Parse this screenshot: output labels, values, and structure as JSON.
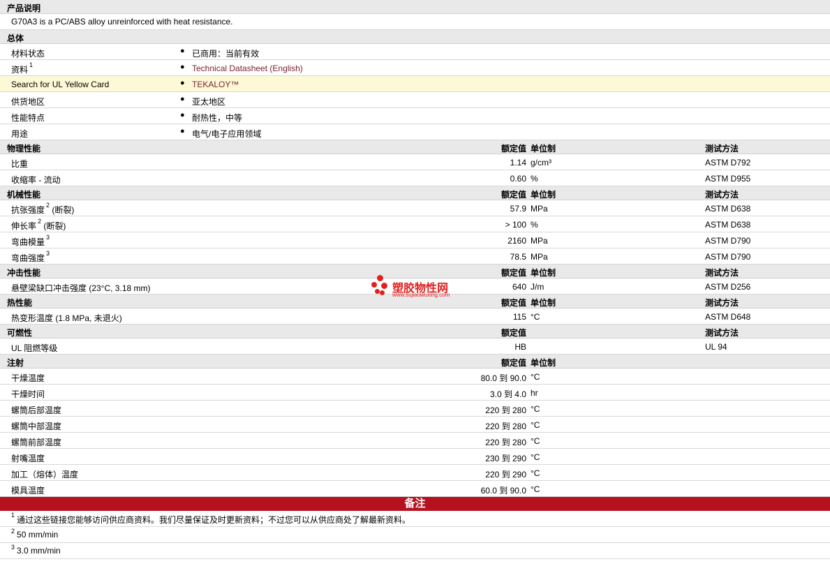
{
  "product": {
    "section": "产品说明",
    "description": "G70A3 is a PC/ABS alloy unreinforced with heat resistance."
  },
  "general": {
    "section": "总体",
    "rows": [
      {
        "label": "材料状态",
        "sup": "",
        "value": "已商用：当前有效",
        "link": false
      },
      {
        "label": "资料",
        "sup": "1",
        "value": "Technical Datasheet (English)",
        "link": true
      },
      {
        "label": "Search for UL Yellow Card",
        "sup": "",
        "value": "TEKALOY™",
        "link": true
      },
      {
        "label": "供货地区",
        "sup": "",
        "value": "亚太地区",
        "link": false
      },
      {
        "label": "性能特点",
        "sup": "",
        "value": "耐热性，中等",
        "link": false
      },
      {
        "label": "用途",
        "sup": "",
        "value": "电气/电子应用领域",
        "link": false
      }
    ]
  },
  "headers": {
    "nominal": "额定值",
    "unit": "单位制",
    "method": "测试方法"
  },
  "physical": {
    "section": "物理性能",
    "rows": [
      {
        "label": "比重",
        "sup": "",
        "value": "1.14",
        "unit": "g/cm³",
        "method": "ASTM D792"
      },
      {
        "label": "收缩率  - 流动",
        "sup": "",
        "value": "0.60",
        "unit": "%",
        "method": "ASTM D955"
      }
    ]
  },
  "mechanical": {
    "section": "机械性能",
    "rows": [
      {
        "label": "抗张强度",
        "sup": "2",
        "suffix": " (断裂)",
        "value": "57.9",
        "unit": "MPa",
        "method": "ASTM D638"
      },
      {
        "label": "伸长率",
        "sup": "2",
        "suffix": " (断裂)",
        "value": "> 100",
        "unit": "%",
        "method": "ASTM D638"
      },
      {
        "label": "弯曲模量",
        "sup": "3",
        "suffix": "",
        "value": "2160",
        "unit": "MPa",
        "method": "ASTM D790"
      },
      {
        "label": "弯曲强度",
        "sup": "3",
        "suffix": "",
        "value": "78.5",
        "unit": "MPa",
        "method": "ASTM D790"
      }
    ]
  },
  "impact": {
    "section": "冲击性能",
    "rows": [
      {
        "label": "悬壁梁缺口冲击强度 (23°C, 3.18 mm)",
        "value": "640",
        "unit": "J/m",
        "method": "ASTM D256"
      }
    ]
  },
  "thermal": {
    "section": "热性能",
    "rows": [
      {
        "label": "热变形温度 (1.8 MPa, 未退火)",
        "value": "115",
        "unit": "°C",
        "method": "ASTM D648"
      }
    ]
  },
  "flammability": {
    "section": "可燃性",
    "rows": [
      {
        "label": "UL 阻燃等级",
        "value": "HB",
        "unit": "",
        "method": "UL 94"
      }
    ]
  },
  "injection": {
    "section": "注射",
    "rows": [
      {
        "label": "干燥温度",
        "value": "80.0 到  90.0",
        "unit": "°C"
      },
      {
        "label": "干燥时间",
        "value": "3.0 到  4.0",
        "unit": "hr"
      },
      {
        "label": "螺筒后部温度",
        "value": "220 到  280",
        "unit": "°C"
      },
      {
        "label": "螺筒中部温度",
        "value": "220 到  280",
        "unit": "°C"
      },
      {
        "label": "螺筒前部温度",
        "value": "220 到  280",
        "unit": "°C"
      },
      {
        "label": "射嘴温度",
        "value": "230 到  290",
        "unit": "°C"
      },
      {
        "label": "加工（熔体）温度",
        "value": "220 到  290",
        "unit": "°C"
      },
      {
        "label": "模具温度",
        "value": "60.0 到  90.0",
        "unit": "°C"
      }
    ]
  },
  "notes": {
    "title": "备注",
    "items": [
      {
        "num": "1",
        "text": "通过这些链接您能够访问供应商资料。我们尽量保证及时更新资料；不过您可以从供应商处了解最新资料。"
      },
      {
        "num": "2",
        "text": "50 mm/min"
      },
      {
        "num": "3",
        "text": "3.0 mm/min"
      }
    ]
  },
  "watermark": {
    "name": "塑胶物性网",
    "url": "www.sujiaowuxing.com",
    "color": "#e2201f"
  },
  "colors": {
    "notes_bar": "#b5121f",
    "link": "#7a1f2e",
    "highlight": "#fdf9d6",
    "section_bg": "#e9e9e9"
  }
}
